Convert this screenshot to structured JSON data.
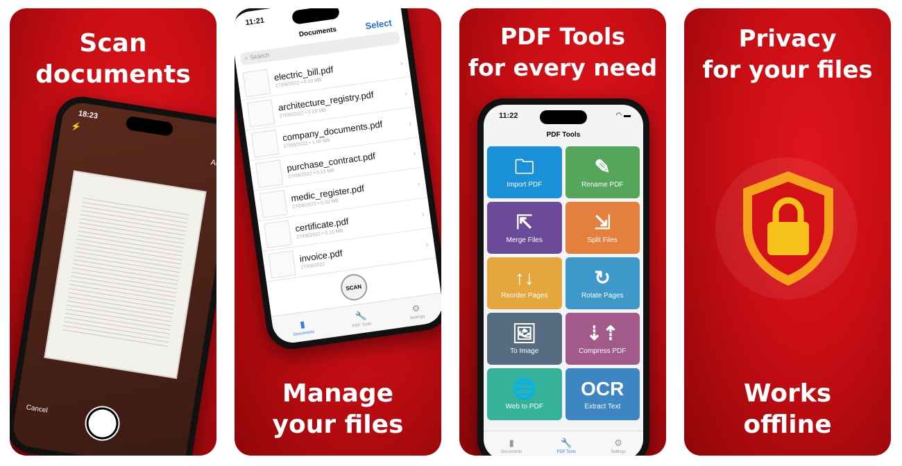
{
  "panels": [
    {
      "headline_1": "Scan",
      "headline_2": "documents",
      "status_time": "18:23",
      "auto_label": "Auto",
      "cancel_label": "Cancel"
    },
    {
      "headline_1": "Manage",
      "headline_2": "your files",
      "status_time": "11:21",
      "title": "Documents",
      "select_label": "Select",
      "search_placeholder": "Search",
      "scan_label": "SCAN",
      "files": [
        {
          "name": "electric_bill.pdf",
          "meta": "27/09/2022 • 0.10 MB"
        },
        {
          "name": "architecture_registry.pdf",
          "meta": "27/09/2022 • 0.18 MB"
        },
        {
          "name": "company_documents.pdf",
          "meta": "27/09/2022 • 1.00 MB"
        },
        {
          "name": "purchase_contract.pdf",
          "meta": "27/09/2022 • 0.13 MB"
        },
        {
          "name": "medic_register.pdf",
          "meta": "27/09/2022 • 0.10 MB"
        },
        {
          "name": "certificate.pdf",
          "meta": "27/09/2022 • 0.15 MB"
        },
        {
          "name": "invoice.pdf",
          "meta": "27/09/2022"
        }
      ],
      "tabs": [
        "Documents",
        "PDF Tools",
        "Settings"
      ]
    },
    {
      "headline_1": "PDF Tools",
      "headline_2": "for every need",
      "status_time": "11:22",
      "title": "PDF Tools",
      "tools": [
        {
          "label": "Import PDF",
          "icon": "folder-icon",
          "glyph": "🗀",
          "color": "#1a90d8"
        },
        {
          "label": "Rename PDF",
          "icon": "pencil-icon",
          "glyph": "✎",
          "color": "#55a55a"
        },
        {
          "label": "Merge Files",
          "icon": "merge-files-icon",
          "glyph": "⇱",
          "color": "#6b4a9a"
        },
        {
          "label": "Split Files",
          "icon": "split-files-icon",
          "glyph": "⇲",
          "color": "#e57f3e"
        },
        {
          "label": "Reorder Pages",
          "icon": "reorder-arrows-icon",
          "glyph": "↑↓",
          "color": "#e4a63d"
        },
        {
          "label": "Rotate Pages",
          "icon": "rotate-icon",
          "glyph": "↻",
          "color": "#3e98c9"
        },
        {
          "label": "To Image",
          "icon": "image-icon",
          "glyph": "🖼",
          "color": "#566c80"
        },
        {
          "label": "Compress PDF",
          "icon": "compress-icon",
          "glyph": "⇣⇡",
          "color": "#a25a8a"
        },
        {
          "label": "Web to PDF",
          "icon": "globe-icon",
          "glyph": "🌐",
          "color": "#36b29a"
        },
        {
          "label": "Extract Text",
          "icon": "ocr-icon",
          "glyph": "OCR",
          "color": "#3e85c4"
        }
      ],
      "tabs": [
        "Documents",
        "PDF Tools",
        "Settings"
      ]
    },
    {
      "headline_1": "Privacy",
      "headline_2": "for your files",
      "headline_3": "Works",
      "headline_4": "offline"
    }
  ],
  "colors": {
    "brand_red": "#c80d14",
    "accent_blue": "#2f80ed",
    "shield_yellow": "#f6c21a"
  }
}
